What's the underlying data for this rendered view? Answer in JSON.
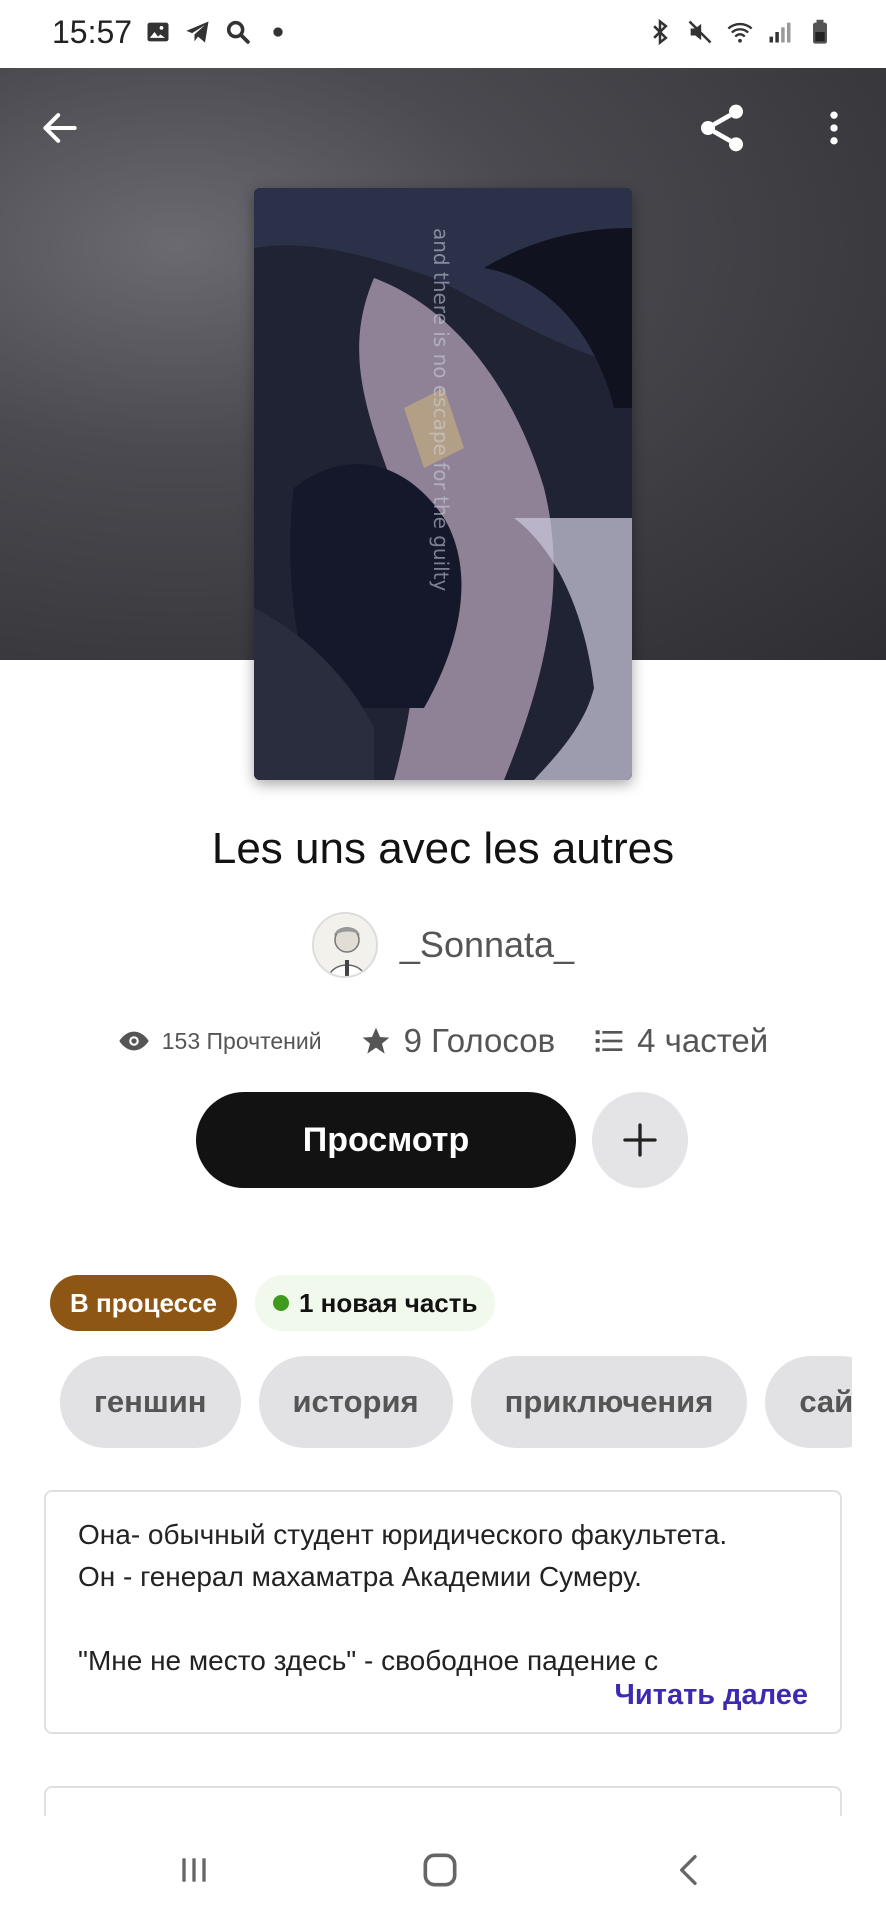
{
  "status_bar": {
    "time": "15:57",
    "left_icons": [
      "image-icon",
      "telegram-icon",
      "search-icon",
      "dot-icon"
    ],
    "right_icons": [
      "bluetooth-icon",
      "mute-icon",
      "wifi-icon",
      "signal-icon",
      "battery-icon"
    ]
  },
  "header": {
    "back_icon": "arrow-left-icon",
    "share_icon": "share-icon",
    "more_icon": "more-vertical-icon"
  },
  "cover": {
    "text": "and there is no escape for the guilty"
  },
  "story": {
    "title": "Les uns avec les autres",
    "author": "_Sonnata_"
  },
  "stats": {
    "reads": "153 Прочтений",
    "votes": "9 Голосов",
    "parts": "4 частей"
  },
  "actions": {
    "read_label": "Просмотр",
    "add_icon": "plus-icon"
  },
  "badges": {
    "status": "В процессе",
    "new_part": "1 новая часть"
  },
  "tags": [
    "геншин",
    "история",
    "приключения",
    "сай"
  ],
  "description": {
    "line1": "Она- обычный студент юридического факультета.",
    "line2": "Он - генерал махаматра Академии Сумеру.",
    "line3": "",
    "line4": "\"Мне не место здесь\" - свободное падение с",
    "read_more": "Читать далее"
  },
  "nav_bar": {
    "icons": [
      "recent-apps-icon",
      "home-icon",
      "back-icon"
    ]
  },
  "colors": {
    "status_badge": "#8e5614",
    "new_dot": "#3f9b1f",
    "read_more": "#3c2bb0",
    "primary_button": "#121212"
  }
}
